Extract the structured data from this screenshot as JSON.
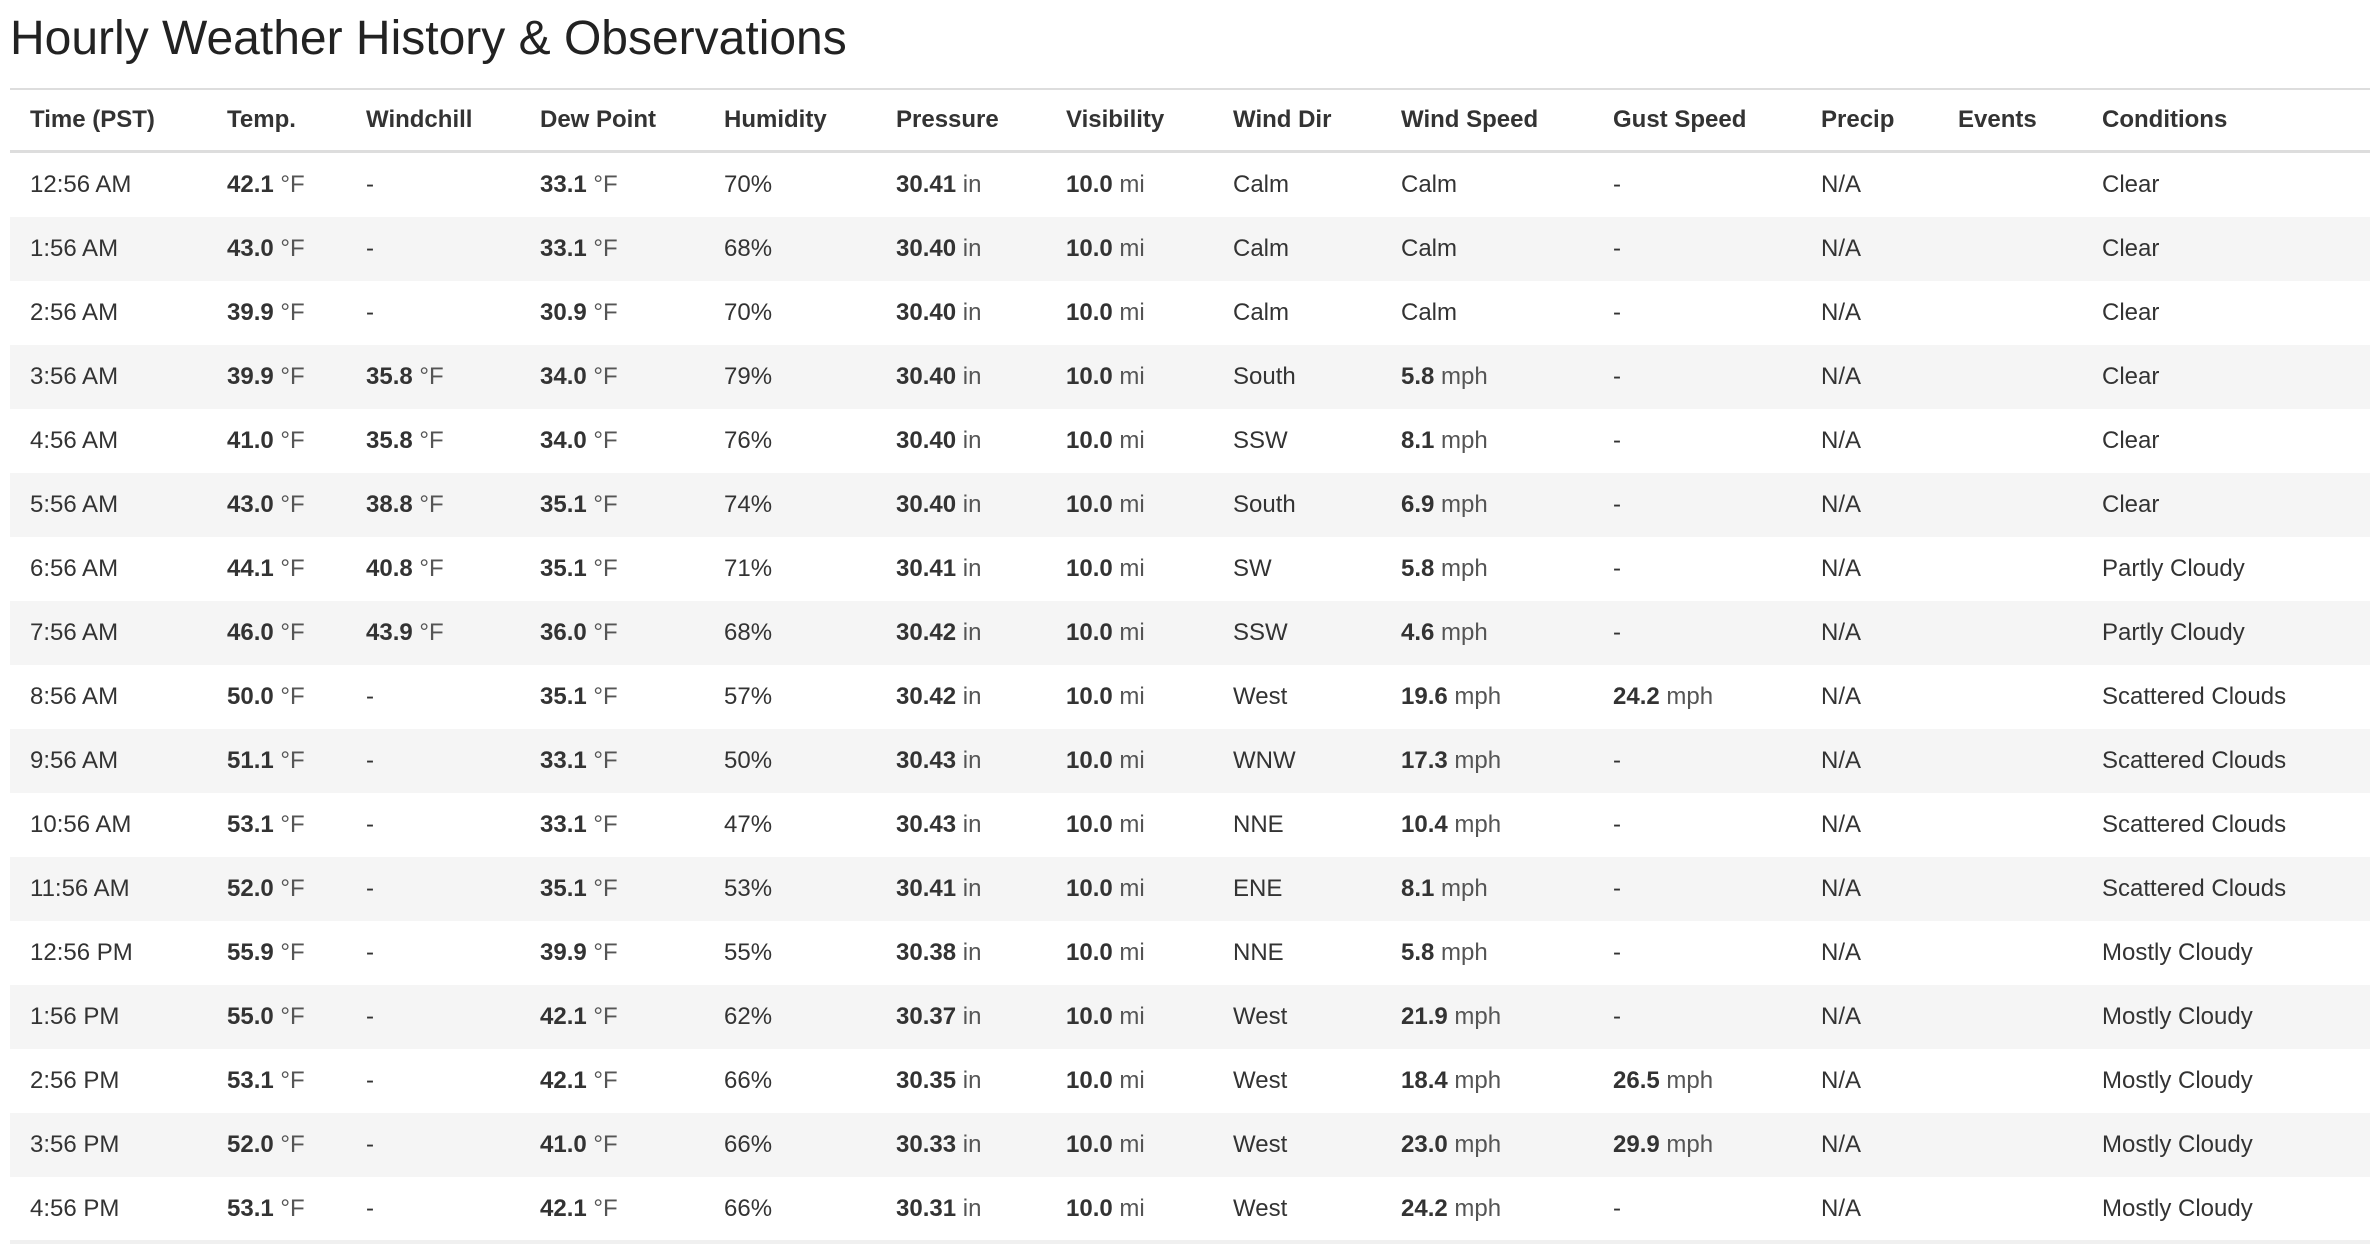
{
  "page": {
    "title": "Hourly Weather History & Observations"
  },
  "table": {
    "columns": [
      {
        "key": "time",
        "label": "Time (PST)"
      },
      {
        "key": "temp",
        "label": "Temp."
      },
      {
        "key": "windchill",
        "label": "Windchill"
      },
      {
        "key": "dew_point",
        "label": "Dew Point"
      },
      {
        "key": "humidity",
        "label": "Humidity"
      },
      {
        "key": "pressure",
        "label": "Pressure"
      },
      {
        "key": "visibility",
        "label": "Visibility"
      },
      {
        "key": "wind_dir",
        "label": "Wind Dir"
      },
      {
        "key": "wind_speed",
        "label": "Wind Speed"
      },
      {
        "key": "gust_speed",
        "label": "Gust Speed"
      },
      {
        "key": "precip",
        "label": "Precip"
      },
      {
        "key": "events",
        "label": "Events"
      },
      {
        "key": "conditions",
        "label": "Conditions"
      }
    ],
    "rows": [
      {
        "time": "12:56 AM",
        "temp": [
          "42.1",
          "°F"
        ],
        "windchill": "-",
        "dew_point": [
          "33.1",
          "°F"
        ],
        "humidity": "70%",
        "pressure": [
          "30.41",
          "in"
        ],
        "visibility": [
          "10.0",
          "mi"
        ],
        "wind_dir": "Calm",
        "wind_speed": "Calm",
        "gust_speed": "-",
        "precip": "N/A",
        "events": "",
        "conditions": "Clear"
      },
      {
        "time": "1:56 AM",
        "temp": [
          "43.0",
          "°F"
        ],
        "windchill": "-",
        "dew_point": [
          "33.1",
          "°F"
        ],
        "humidity": "68%",
        "pressure": [
          "30.40",
          "in"
        ],
        "visibility": [
          "10.0",
          "mi"
        ],
        "wind_dir": "Calm",
        "wind_speed": "Calm",
        "gust_speed": "-",
        "precip": "N/A",
        "events": "",
        "conditions": "Clear"
      },
      {
        "time": "2:56 AM",
        "temp": [
          "39.9",
          "°F"
        ],
        "windchill": "-",
        "dew_point": [
          "30.9",
          "°F"
        ],
        "humidity": "70%",
        "pressure": [
          "30.40",
          "in"
        ],
        "visibility": [
          "10.0",
          "mi"
        ],
        "wind_dir": "Calm",
        "wind_speed": "Calm",
        "gust_speed": "-",
        "precip": "N/A",
        "events": "",
        "conditions": "Clear"
      },
      {
        "time": "3:56 AM",
        "temp": [
          "39.9",
          "°F"
        ],
        "windchill": [
          "35.8",
          "°F"
        ],
        "dew_point": [
          "34.0",
          "°F"
        ],
        "humidity": "79%",
        "pressure": [
          "30.40",
          "in"
        ],
        "visibility": [
          "10.0",
          "mi"
        ],
        "wind_dir": "South",
        "wind_speed": [
          "5.8",
          "mph"
        ],
        "gust_speed": "-",
        "precip": "N/A",
        "events": "",
        "conditions": "Clear"
      },
      {
        "time": "4:56 AM",
        "temp": [
          "41.0",
          "°F"
        ],
        "windchill": [
          "35.8",
          "°F"
        ],
        "dew_point": [
          "34.0",
          "°F"
        ],
        "humidity": "76%",
        "pressure": [
          "30.40",
          "in"
        ],
        "visibility": [
          "10.0",
          "mi"
        ],
        "wind_dir": "SSW",
        "wind_speed": [
          "8.1",
          "mph"
        ],
        "gust_speed": "-",
        "precip": "N/A",
        "events": "",
        "conditions": "Clear"
      },
      {
        "time": "5:56 AM",
        "temp": [
          "43.0",
          "°F"
        ],
        "windchill": [
          "38.8",
          "°F"
        ],
        "dew_point": [
          "35.1",
          "°F"
        ],
        "humidity": "74%",
        "pressure": [
          "30.40",
          "in"
        ],
        "visibility": [
          "10.0",
          "mi"
        ],
        "wind_dir": "South",
        "wind_speed": [
          "6.9",
          "mph"
        ],
        "gust_speed": "-",
        "precip": "N/A",
        "events": "",
        "conditions": "Clear"
      },
      {
        "time": "6:56 AM",
        "temp": [
          "44.1",
          "°F"
        ],
        "windchill": [
          "40.8",
          "°F"
        ],
        "dew_point": [
          "35.1",
          "°F"
        ],
        "humidity": "71%",
        "pressure": [
          "30.41",
          "in"
        ],
        "visibility": [
          "10.0",
          "mi"
        ],
        "wind_dir": "SW",
        "wind_speed": [
          "5.8",
          "mph"
        ],
        "gust_speed": "-",
        "precip": "N/A",
        "events": "",
        "conditions": "Partly Cloudy"
      },
      {
        "time": "7:56 AM",
        "temp": [
          "46.0",
          "°F"
        ],
        "windchill": [
          "43.9",
          "°F"
        ],
        "dew_point": [
          "36.0",
          "°F"
        ],
        "humidity": "68%",
        "pressure": [
          "30.42",
          "in"
        ],
        "visibility": [
          "10.0",
          "mi"
        ],
        "wind_dir": "SSW",
        "wind_speed": [
          "4.6",
          "mph"
        ],
        "gust_speed": "-",
        "precip": "N/A",
        "events": "",
        "conditions": "Partly Cloudy"
      },
      {
        "time": "8:56 AM",
        "temp": [
          "50.0",
          "°F"
        ],
        "windchill": "-",
        "dew_point": [
          "35.1",
          "°F"
        ],
        "humidity": "57%",
        "pressure": [
          "30.42",
          "in"
        ],
        "visibility": [
          "10.0",
          "mi"
        ],
        "wind_dir": "West",
        "wind_speed": [
          "19.6",
          "mph"
        ],
        "gust_speed": [
          "24.2",
          "mph"
        ],
        "precip": "N/A",
        "events": "",
        "conditions": "Scattered Clouds"
      },
      {
        "time": "9:56 AM",
        "temp": [
          "51.1",
          "°F"
        ],
        "windchill": "-",
        "dew_point": [
          "33.1",
          "°F"
        ],
        "humidity": "50%",
        "pressure": [
          "30.43",
          "in"
        ],
        "visibility": [
          "10.0",
          "mi"
        ],
        "wind_dir": "WNW",
        "wind_speed": [
          "17.3",
          "mph"
        ],
        "gust_speed": "-",
        "precip": "N/A",
        "events": "",
        "conditions": "Scattered Clouds"
      },
      {
        "time": "10:56 AM",
        "temp": [
          "53.1",
          "°F"
        ],
        "windchill": "-",
        "dew_point": [
          "33.1",
          "°F"
        ],
        "humidity": "47%",
        "pressure": [
          "30.43",
          "in"
        ],
        "visibility": [
          "10.0",
          "mi"
        ],
        "wind_dir": "NNE",
        "wind_speed": [
          "10.4",
          "mph"
        ],
        "gust_speed": "-",
        "precip": "N/A",
        "events": "",
        "conditions": "Scattered Clouds"
      },
      {
        "time": "11:56 AM",
        "temp": [
          "52.0",
          "°F"
        ],
        "windchill": "-",
        "dew_point": [
          "35.1",
          "°F"
        ],
        "humidity": "53%",
        "pressure": [
          "30.41",
          "in"
        ],
        "visibility": [
          "10.0",
          "mi"
        ],
        "wind_dir": "ENE",
        "wind_speed": [
          "8.1",
          "mph"
        ],
        "gust_speed": "-",
        "precip": "N/A",
        "events": "",
        "conditions": "Scattered Clouds"
      },
      {
        "time": "12:56 PM",
        "temp": [
          "55.9",
          "°F"
        ],
        "windchill": "-",
        "dew_point": [
          "39.9",
          "°F"
        ],
        "humidity": "55%",
        "pressure": [
          "30.38",
          "in"
        ],
        "visibility": [
          "10.0",
          "mi"
        ],
        "wind_dir": "NNE",
        "wind_speed": [
          "5.8",
          "mph"
        ],
        "gust_speed": "-",
        "precip": "N/A",
        "events": "",
        "conditions": "Mostly Cloudy"
      },
      {
        "time": "1:56 PM",
        "temp": [
          "55.0",
          "°F"
        ],
        "windchill": "-",
        "dew_point": [
          "42.1",
          "°F"
        ],
        "humidity": "62%",
        "pressure": [
          "30.37",
          "in"
        ],
        "visibility": [
          "10.0",
          "mi"
        ],
        "wind_dir": "West",
        "wind_speed": [
          "21.9",
          "mph"
        ],
        "gust_speed": "-",
        "precip": "N/A",
        "events": "",
        "conditions": "Mostly Cloudy"
      },
      {
        "time": "2:56 PM",
        "temp": [
          "53.1",
          "°F"
        ],
        "windchill": "-",
        "dew_point": [
          "42.1",
          "°F"
        ],
        "humidity": "66%",
        "pressure": [
          "30.35",
          "in"
        ],
        "visibility": [
          "10.0",
          "mi"
        ],
        "wind_dir": "West",
        "wind_speed": [
          "18.4",
          "mph"
        ],
        "gust_speed": [
          "26.5",
          "mph"
        ],
        "precip": "N/A",
        "events": "",
        "conditions": "Mostly Cloudy"
      },
      {
        "time": "3:56 PM",
        "temp": [
          "52.0",
          "°F"
        ],
        "windchill": "-",
        "dew_point": [
          "41.0",
          "°F"
        ],
        "humidity": "66%",
        "pressure": [
          "30.33",
          "in"
        ],
        "visibility": [
          "10.0",
          "mi"
        ],
        "wind_dir": "West",
        "wind_speed": [
          "23.0",
          "mph"
        ],
        "gust_speed": [
          "29.9",
          "mph"
        ],
        "precip": "N/A",
        "events": "",
        "conditions": "Mostly Cloudy"
      },
      {
        "time": "4:56 PM",
        "temp": [
          "53.1",
          "°F"
        ],
        "windchill": "-",
        "dew_point": [
          "42.1",
          "°F"
        ],
        "humidity": "66%",
        "pressure": [
          "30.31",
          "in"
        ],
        "visibility": [
          "10.0",
          "mi"
        ],
        "wind_dir": "West",
        "wind_speed": [
          "24.2",
          "mph"
        ],
        "gust_speed": "-",
        "precip": "N/A",
        "events": "",
        "conditions": "Mostly Cloudy"
      }
    ]
  }
}
